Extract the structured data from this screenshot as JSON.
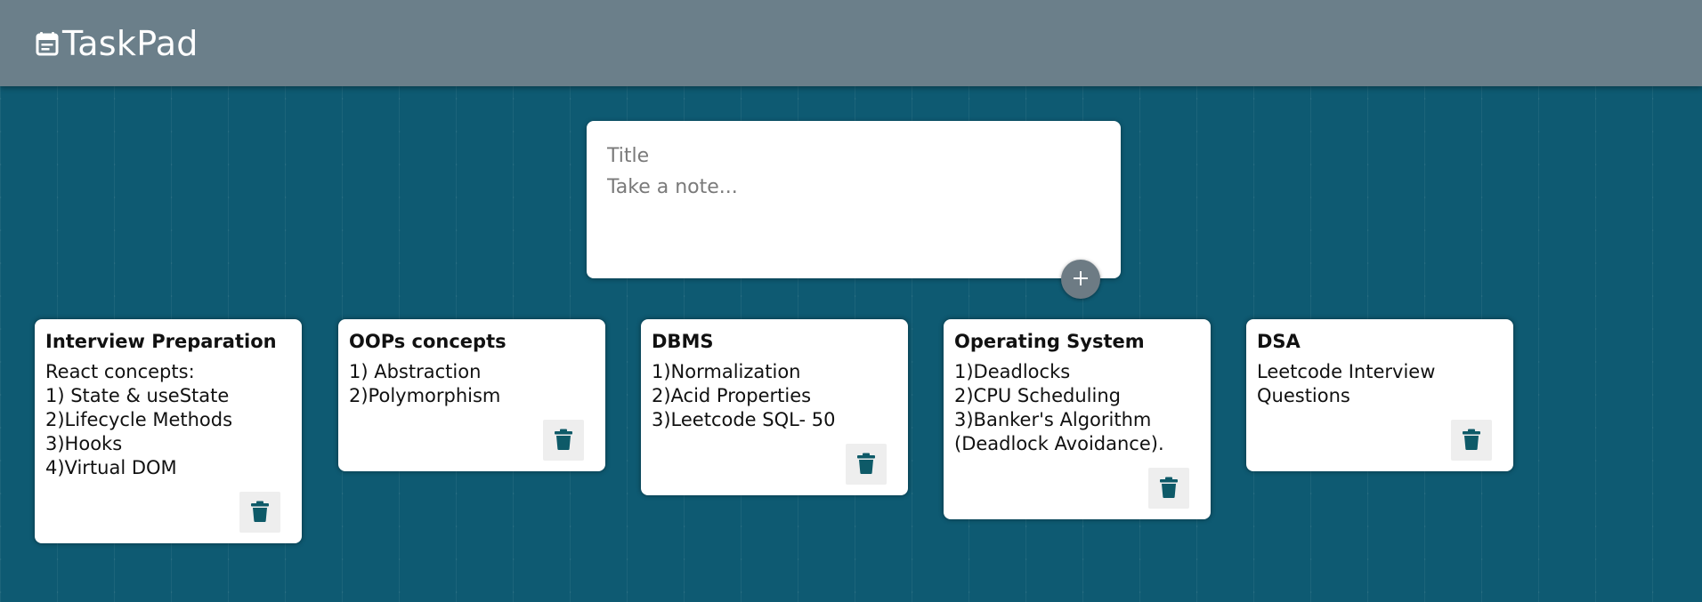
{
  "app": {
    "title": "TaskPad",
    "icon": "note-calendar-icon"
  },
  "composer": {
    "title_placeholder": "Title",
    "body_placeholder": "Take a note...",
    "add_icon": "plus-icon"
  },
  "notes": [
    {
      "title": "Interview Preparation",
      "lines": [
        "React concepts:",
        "1) State & useState",
        "2)Lifecycle Methods",
        "3)Hooks",
        "4)Virtual DOM"
      ],
      "delete_icon": "trash-icon"
    },
    {
      "title": "OOPs concepts",
      "lines": [
        "1) Abstraction",
        "2)Polymorphism"
      ],
      "delete_icon": "trash-icon"
    },
    {
      "title": "DBMS",
      "lines": [
        "1)Normalization",
        "2)Acid Properties",
        "3)Leetcode SQL- 50"
      ],
      "delete_icon": "trash-icon"
    },
    {
      "title": "Operating System",
      "lines": [
        "1)Deadlocks",
        "2)CPU Scheduling",
        "3)Banker's Algorithm",
        "(Deadlock Avoidance)."
      ],
      "delete_icon": "trash-icon"
    },
    {
      "title": "DSA",
      "lines": [
        "Leetcode Interview",
        "Questions"
      ],
      "delete_icon": "trash-icon"
    }
  ],
  "colors": {
    "header": "#6b7f8a",
    "background": "#0e5a72",
    "accent": "#0e5a68",
    "add_button": "#6d7b84"
  }
}
